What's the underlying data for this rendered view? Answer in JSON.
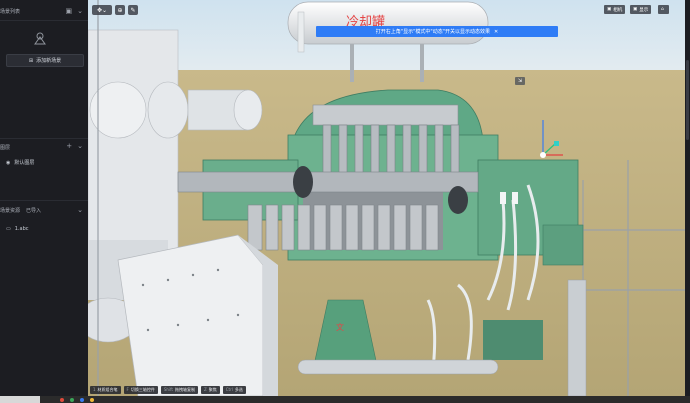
{
  "sidebar": {
    "scene_list": {
      "title": "场景列表"
    },
    "add_scene_label": "添加新场景",
    "layers": {
      "title": "图层",
      "items": [
        {
          "label": "默认图层"
        }
      ]
    },
    "resources": {
      "title": "场景资源",
      "status": "已导入",
      "items": [
        {
          "label": "1.abc"
        }
      ]
    }
  },
  "viewport": {
    "toolbar_right": [
      {
        "label": "相机"
      },
      {
        "label": "显示"
      },
      {
        "label": ""
      }
    ],
    "hint_banner": "打开右上角\"显示\"模式中\"动态\"开关以显示动态效果",
    "object_label": "冷却罐",
    "bottom_hints": [
      {
        "key": "1",
        "label": "材质组合笔"
      },
      {
        "key": "F",
        "label": "切换三轴控件"
      },
      {
        "key": "Shift",
        "label": "拖拽轴复制"
      },
      {
        "key": "Z",
        "label": "聚焦"
      },
      {
        "key": "Ctrl",
        "label": "多选"
      }
    ]
  },
  "colors": {
    "accent": "#2f7cf6",
    "label_red": "#e54545",
    "machine_green": "#5fa886"
  }
}
